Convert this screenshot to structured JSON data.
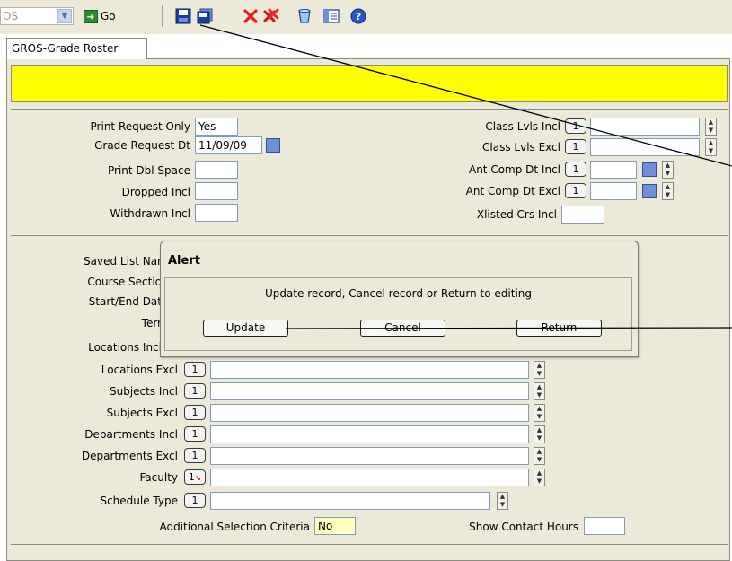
{
  "toolbar": {
    "combo_value": "OS",
    "go_label": "Go"
  },
  "tab": {
    "label": "GROS-Grade Roster"
  },
  "upper": {
    "print_request_only": {
      "label": "Print Request Only",
      "value": "Yes"
    },
    "grade_request_dt": {
      "label": "Grade Request Dt",
      "value": "11/09/09"
    },
    "print_dbl_space": {
      "label": "Print Dbl Space",
      "value": ""
    },
    "dropped_incl": {
      "label": "Dropped Incl",
      "value": ""
    },
    "withdrawn_incl": {
      "label": "Withdrawn Incl",
      "value": ""
    },
    "class_lvls_incl": {
      "label": "Class Lvls Incl",
      "count": "1",
      "value": ""
    },
    "class_lvls_excl": {
      "label": "Class Lvls Excl",
      "count": "1",
      "value": ""
    },
    "ant_comp_dt_incl": {
      "label": "Ant Comp Dt Incl",
      "count": "1",
      "value": ""
    },
    "ant_comp_dt_excl": {
      "label": "Ant Comp Dt Excl",
      "count": "1",
      "value": ""
    },
    "xlisted_crs_incl": {
      "label": "Xlisted Crs Incl",
      "value": ""
    }
  },
  "lower": {
    "saved_list_name": {
      "label": "Saved List Nar"
    },
    "course_section": {
      "label": "Course Sectio"
    },
    "start_end_date": {
      "label": "Start/End Dat"
    },
    "term": {
      "label": "Terr"
    },
    "locations_incl": {
      "label": "Locations Incl"
    },
    "locations_excl": {
      "label": "Locations Excl",
      "count": "1"
    },
    "subjects_incl": {
      "label": "Subjects Incl",
      "count": "1"
    },
    "subjects_excl": {
      "label": "Subjects Excl",
      "count": "1"
    },
    "departments_incl": {
      "label": "Departments Incl",
      "count": "1"
    },
    "departments_excl": {
      "label": "Departments Excl",
      "count": "1"
    },
    "faculty": {
      "label": "Faculty",
      "count": "1"
    },
    "schedule_type": {
      "label": "Schedule Type",
      "count": "1"
    },
    "additional_selection_criteria": {
      "label": "Additional Selection Criteria",
      "value": "No"
    },
    "show_contact_hours": {
      "label": "Show Contact Hours",
      "value": ""
    }
  },
  "alert": {
    "title": "Alert",
    "message": "Update record, Cancel record or Return to editing",
    "update_label": "Update",
    "cancel_label": "Cancel",
    "return_label": "Return"
  },
  "icons": {
    "save": "save-icon",
    "save_all": "save-all-icon",
    "delete": "delete-icon",
    "delete_all": "delete-all-icon",
    "clear": "clear-icon",
    "list": "list-icon",
    "help": "help-icon"
  },
  "colors": {
    "yellow_bar": "#ffff00",
    "annotation_line": "#000000"
  }
}
